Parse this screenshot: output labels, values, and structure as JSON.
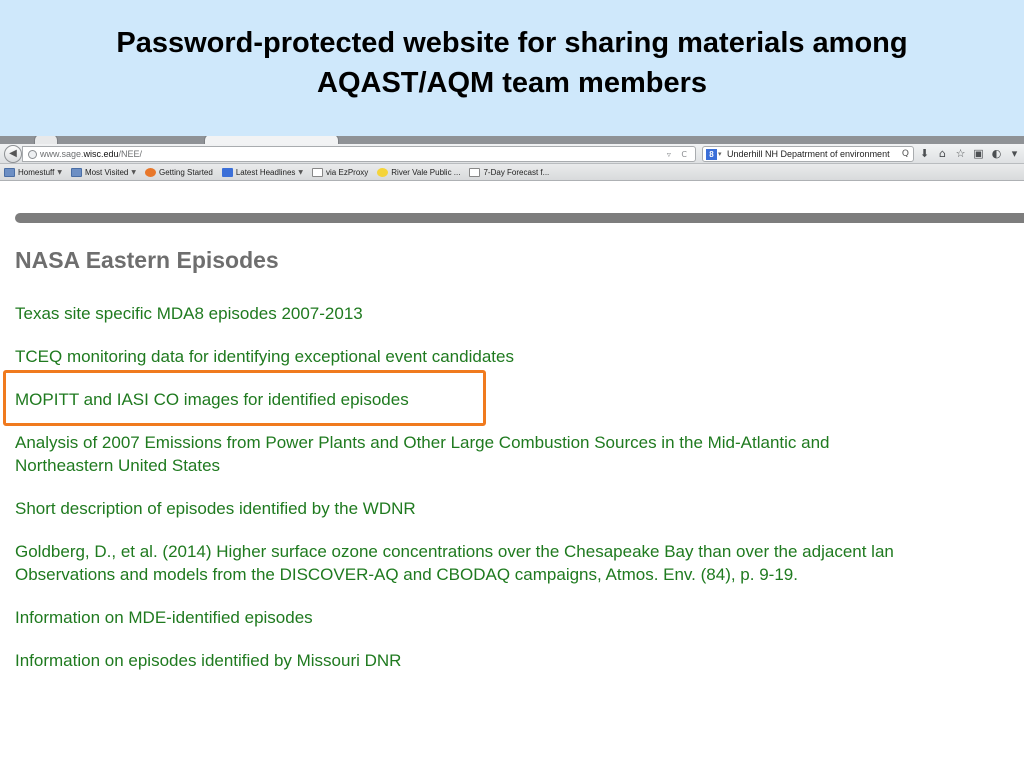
{
  "slide": {
    "title_line1": "Password-protected website for sharing materials among",
    "title_line2": "AQAST/AQM team members"
  },
  "browser": {
    "back_icon": "back-arrow-icon",
    "url_prefix": "www.sage.",
    "url_domain": "wisc.edu",
    "url_path": "/NEE/",
    "url_controls": "▿ C",
    "search_engine_icon": "google-icon",
    "search_engine_label": "8",
    "search_dropdown": "▾",
    "search_value": "Underhill NH Depatrment of environment",
    "search_go": "Q",
    "toolbar_icons": [
      {
        "name": "download-icon",
        "glyph": "⬇"
      },
      {
        "name": "home-icon",
        "glyph": "⌂"
      },
      {
        "name": "bookmark-star-icon",
        "glyph": "☆"
      },
      {
        "name": "bookmarks-menu-icon",
        "glyph": "▣"
      },
      {
        "name": "addon-icon",
        "glyph": "◐"
      },
      {
        "name": "menu-icon",
        "glyph": "▾"
      }
    ],
    "bookmarks": [
      {
        "label": "Homestuff",
        "icon": "folder",
        "dropdown": true
      },
      {
        "label": "Most Visited",
        "icon": "folder",
        "dropdown": true
      },
      {
        "label": "Getting Started",
        "icon": "fox",
        "dropdown": false
      },
      {
        "label": "Latest Headlines",
        "icon": "news",
        "dropdown": true
      },
      {
        "label": "via EzProxy",
        "icon": "blank",
        "dropdown": false
      },
      {
        "label": "River Vale Public ...",
        "icon": "star",
        "dropdown": false
      },
      {
        "label": "7-Day Forecast f...",
        "icon": "blank",
        "dropdown": false
      }
    ]
  },
  "page": {
    "heading": "NASA Eastern Episodes",
    "links": [
      {
        "lines": [
          "Texas site specific MDA8 episodes 2007-2013"
        ]
      },
      {
        "lines": [
          "TCEQ monitoring data for identifying exceptional event candidates"
        ]
      },
      {
        "lines": [
          "MOPITT and IASI CO images for identified episodes"
        ],
        "highlighted": true
      },
      {
        "lines": [
          "Analysis of 2007 Emissions from Power Plants and Other Large Combustion Sources in the Mid-Atlantic and",
          "Northeastern United States"
        ]
      },
      {
        "lines": [
          "Short description of episodes identified by the WDNR"
        ]
      },
      {
        "lines": [
          "Goldberg, D., et al. (2014) Higher surface ozone concentrations over the Chesapeake Bay than over the adjacent lan",
          "Observations and models from the DISCOVER-AQ and CBODAQ campaigns, Atmos. Env. (84), p. 9-19."
        ]
      },
      {
        "lines": [
          "Information on MDE-identified episodes"
        ]
      },
      {
        "lines": [
          "Information on episodes identified by Missouri DNR"
        ]
      }
    ]
  },
  "colors": {
    "header_bg": "#cfe8fb",
    "link_green": "#1f7a1f",
    "heading_gray": "#6e6e6e",
    "highlight_orange": "#f07a1e"
  }
}
